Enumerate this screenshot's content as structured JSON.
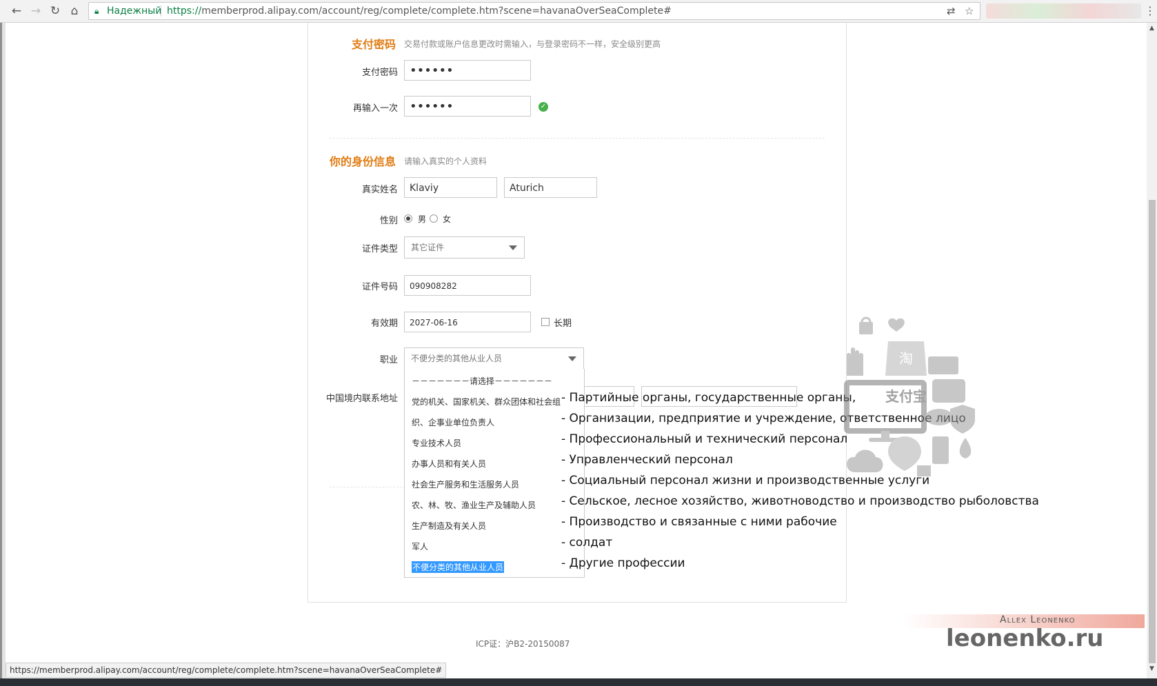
{
  "browser": {
    "secure_label": "Надежный",
    "url_scheme": "https://",
    "url_rest": "memberprod.alipay.com/account/reg/complete/complete.htm?scene=havanaOverSeaComplete#"
  },
  "pay_password": {
    "title": "支付密码",
    "subtitle": "交易付款或账户信息更改时需输入，与登录密码不一样，安全级别更高",
    "password_label": "支付密码",
    "password_value": "••••••",
    "confirm_label": "再输入一次",
    "confirm_value": "••••••"
  },
  "identity": {
    "title": "你的身份信息",
    "subtitle": "请输入真实的个人资料",
    "name_label": "真实姓名",
    "first_name": "Klaviy",
    "last_name": "Aturich",
    "gender_label": "性别",
    "gender_male": "男",
    "gender_female": "女",
    "doc_type_label": "证件类型",
    "doc_type_value": "其它证件",
    "doc_number_label": "证件号码",
    "doc_number_value": "090908282",
    "valid_label": "有效期",
    "valid_value": "2027-06-16",
    "long_term_label": "长期",
    "occupation_label": "职业",
    "occupation_value": "不便分类的其他从业人员",
    "address_label": "中国境内联系地址"
  },
  "occupation_options": [
    "－－－－－－－请选择－－－－－－－",
    "党的机关、国家机关、群众团体和社会组",
    "织、企事业单位负责人",
    "专业技术人员",
    "办事人员和有关人员",
    "社会生产服务和生活服务人员",
    "农、林、牧、渔业生产及辅助人员",
    "生产制造及有关人员",
    "军人",
    "不便分类的其他从业人员"
  ],
  "translations": [
    "- Партийные органы, государственные органы,",
    "- Организации, предприятие и учреждение, ответственное лицо",
    "- Профессиональный и технический персонал",
    "- Управленческий персонал",
    "- Социальный персонал жизни и производственные услуги",
    "- Сельское, лесное хозяйство, животноводство и производство рыболовства",
    "- Производство и связанные с ними рабочие",
    "- солдат",
    "- Другие профессии"
  ],
  "footer": {
    "icp": "ICP证：沪B2-20150087",
    "status_url": "https://memberprod.alipay.com/account/reg/complete/complete.htm?scene=havanaOverSeaComplete#"
  },
  "watermark": {
    "author": "Allex Leonenko",
    "site": "leonenko.ru"
  },
  "colors": {
    "section_title": "#e07c13",
    "success": "#46b04a",
    "selected_option": "#3399ff"
  }
}
